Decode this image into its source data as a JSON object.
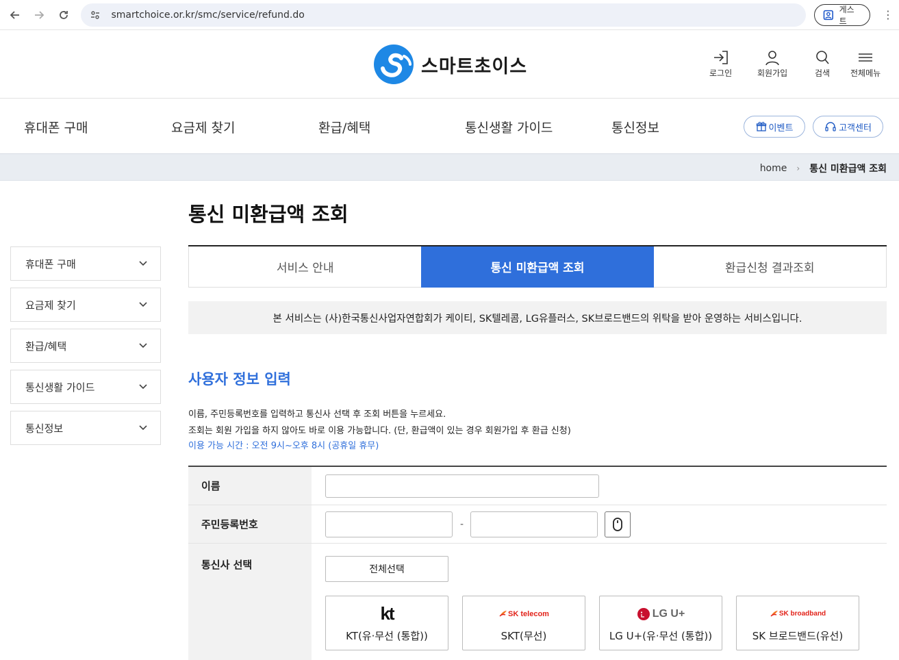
{
  "browser": {
    "url": "smartchoice.or.kr/smc/service/refund.do",
    "profile_label": "게스트"
  },
  "header": {
    "logo_text": "스마트초이스",
    "utils": [
      {
        "label": "로그인",
        "icon": "login-icon"
      },
      {
        "label": "회원가입",
        "icon": "user-icon"
      },
      {
        "label": "검색",
        "icon": "search-icon"
      },
      {
        "label": "전체메뉴",
        "icon": "menu-icon"
      }
    ]
  },
  "gnb": {
    "items": [
      "휴대폰 구매",
      "요금제 찾기",
      "환급/혜택",
      "통신생활 가이드",
      "통신정보"
    ],
    "event_label": "이벤트",
    "support_label": "고객센터"
  },
  "breadcrumb": {
    "home": "home",
    "current": "통신 미환급액 조회"
  },
  "sidebar": {
    "items": [
      "휴대폰 구매",
      "요금제 찾기",
      "환급/혜택",
      "통신생활 가이드",
      "통신정보"
    ]
  },
  "main": {
    "title": "통신 미환급액 조회",
    "tabs": [
      "서비스 안내",
      "통신 미환급액 조회",
      "환급신청 결과조회"
    ],
    "active_tab": 1,
    "notice": "본 서비스는 (사)한국통신사업자연합회가 케이티, SK텔레콤, LG유플러스, SK브로드밴드의 위탁을 받아 운영하는 서비스입니다.",
    "section_title": "사용자 정보 입력",
    "desc_line1": "이름, 주민등록번호를 입력하고 통신사 선택 후 조회 버튼을 누르세요.",
    "desc_line2": "조회는 회원 가입을 하지 않아도 바로 이용 가능합니다. (단, 환급액이 있는 경우 회원가입 후 환급 신청)",
    "desc_hours": "이용 가능 시간 : 오전 9시~오후 8시 (공휴일 휴무)"
  },
  "form": {
    "name_label": "이름",
    "name_value": "",
    "rrn_label": "주민등록번호",
    "rrn_front_value": "",
    "rrn_back_value": "",
    "carrier_label": "통신사 선택",
    "select_all_label": "전체선택",
    "carriers": [
      {
        "logo_text": "kt",
        "label": "KT(유·무선 (통합))"
      },
      {
        "logo_text": "SK telecom",
        "label": "SKT(무선)"
      },
      {
        "logo_text": "LG U+",
        "label": "LG U+(유·무선 (통합))"
      },
      {
        "logo_text": "SK broadband",
        "label": "SK 브로드밴드(유선)"
      }
    ]
  },
  "colors": {
    "accent": "#2f6fdb",
    "brand_blue": "#1e88e5",
    "kt_red": "#e2231a",
    "lg_magenta": "#c8102e"
  }
}
